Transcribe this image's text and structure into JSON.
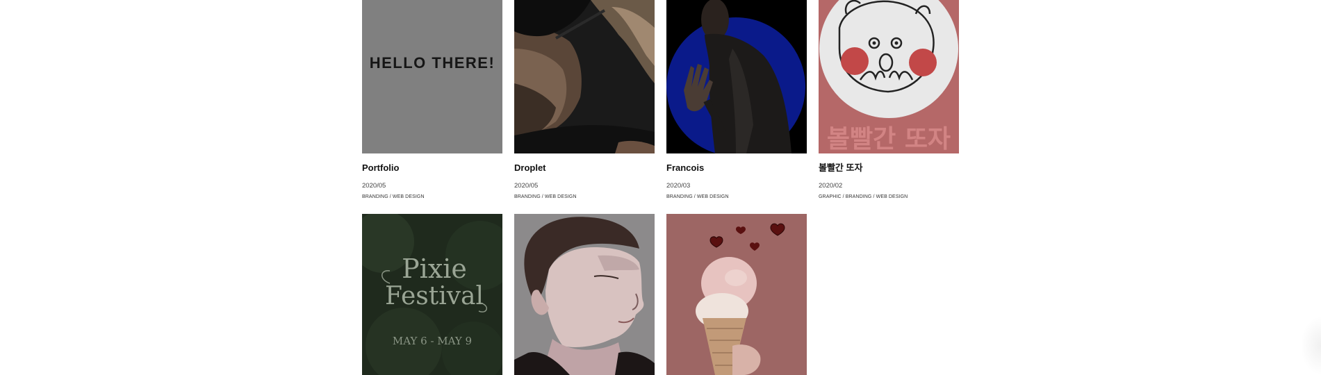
{
  "portfolio": {
    "items": [
      {
        "title": "Portfolio",
        "date": "2020/05",
        "categories": "BRANDING / WEB DESIGN",
        "thumb_text": "HELLO THERE!",
        "thumb_icon": "hello-there-graphic"
      },
      {
        "title": "Droplet",
        "date": "2020/05",
        "categories": "BRANDING / WEB DESIGN",
        "thumb_icon": "bearded-man-photo"
      },
      {
        "title": "Francois",
        "date": "2020/03",
        "categories": "BRANDING / WEB DESIGN",
        "thumb_icon": "man-blue-circle-photo"
      },
      {
        "title": "볼빨간 또자",
        "date": "2020/02",
        "categories": "GRAPHIC / BRANDING / WEB DESIGN",
        "thumb_text": "볼빨간 또자",
        "thumb_icon": "blushing-bear-illustration"
      },
      {
        "title": "",
        "date": "",
        "categories": "",
        "thumb_text_line1": "Pixie",
        "thumb_text_line2": "Festival",
        "thumb_text_line3": "MAY 6 - MAY 9",
        "thumb_icon": "pixie-festival-poster"
      },
      {
        "title": "",
        "date": "",
        "categories": "",
        "thumb_icon": "man-portrait-illustration"
      },
      {
        "title": "",
        "date": "",
        "categories": "",
        "thumb_icon": "ice-cream-hearts-photo"
      }
    ]
  },
  "colors": {
    "background": "#ffffff",
    "title": "#111111",
    "meta": "#444444",
    "thumb_gray": "#808080",
    "thumb_pink": "#b86868",
    "thumb_blue": "#0a1a8a"
  }
}
